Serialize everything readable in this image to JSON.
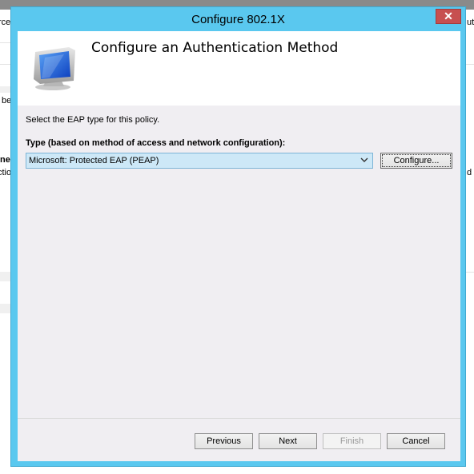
{
  "background": {
    "left_text": [
      "rce",
      "be",
      "ne",
      "ctio"
    ],
    "right_text": [
      "ut",
      "d a"
    ]
  },
  "dialog": {
    "title": "Configure 802.1X",
    "close_glyph": "✕",
    "header_title": "Configure an Authentication Method",
    "instruction": "Select the EAP type for this policy.",
    "type_label": "Type (based on method of access and network configuration):",
    "eap_selected": "Microsoft: Protected EAP (PEAP)",
    "configure_button": "Configure...",
    "buttons": {
      "previous": "Previous",
      "next": "Next",
      "finish": "Finish",
      "cancel": "Cancel"
    }
  },
  "icons": {
    "header": "computer-monitor-icon",
    "dropdown": "chevron-down-icon",
    "close": "close-icon"
  },
  "colors": {
    "title_bar": "#5ac8ef",
    "close_button": "#c75050",
    "select_background": "#cde8f7"
  }
}
